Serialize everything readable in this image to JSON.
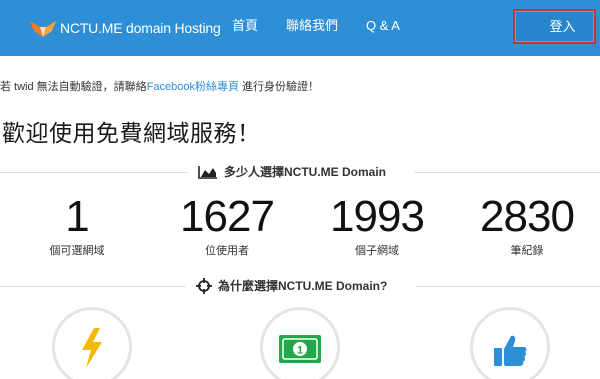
{
  "navbar": {
    "brand": "NCTU.ME domain Hosting",
    "links": [
      "首頁",
      "聯絡我們",
      "Q & A"
    ],
    "login": "登入"
  },
  "notice": {
    "prefix": "若 twid 無法自動驗證，請聯絡",
    "link": "Facebook粉絲專頁",
    "suffix": " 進行身份驗證！"
  },
  "welcome_title": "歡迎使用免費網域服務！",
  "stats_section": {
    "title": "多少人選擇NCTU.ME Domain",
    "items": [
      {
        "value": "1",
        "label": "個可選網域"
      },
      {
        "value": "1627",
        "label": "位使用者"
      },
      {
        "value": "1993",
        "label": "個子網域"
      },
      {
        "value": "2830",
        "label": "筆紀錄"
      }
    ]
  },
  "why_section": {
    "title": "為什麼選擇NCTU.ME Domain?",
    "features": [
      {
        "icon": "lightning-icon",
        "color": "#f5b800"
      },
      {
        "icon": "money-bill-icon",
        "color": "#21a84a"
      },
      {
        "icon": "thumbs-up-icon",
        "color": "#2f8fd6"
      }
    ]
  },
  "colors": {
    "navbar": "#2f8fd6",
    "login_highlight": "#c0392b",
    "link": "#2f8fd6"
  }
}
